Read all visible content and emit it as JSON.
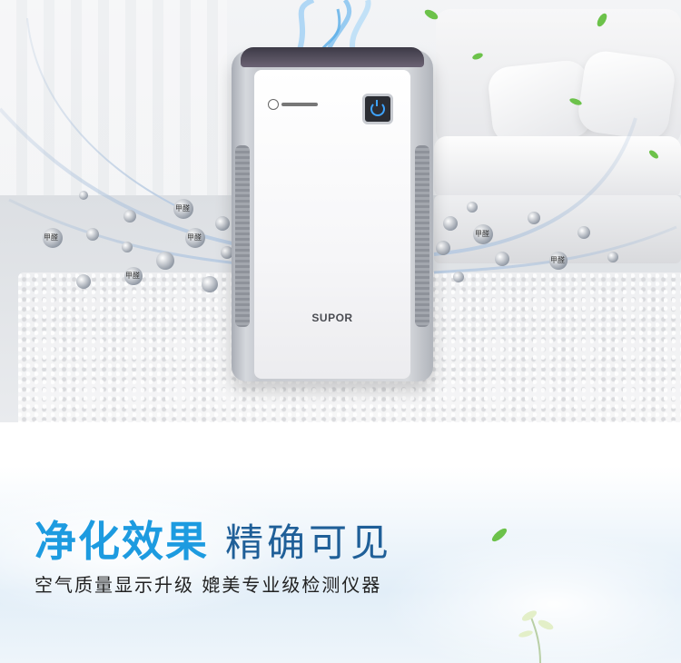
{
  "product": {
    "brand": "SUPOR"
  },
  "overlay": {
    "formaldehyde_label": "甲醛"
  },
  "headline": {
    "strong": "净化效果",
    "light": "精确可见"
  },
  "subline": "空气质量显示升级 媲美专业级检测仪器",
  "colors": {
    "accent_blue": "#1d9be0",
    "dark_blue": "#1f5f98",
    "leaf_green": "#6cc24a",
    "indicator_blue": "#3ea4ff"
  },
  "icons": [
    "power-icon",
    "leaf-icon",
    "formaldehyde-molecule-icon"
  ]
}
